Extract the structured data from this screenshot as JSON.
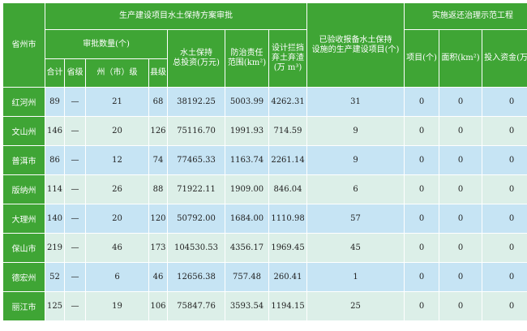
{
  "table": {
    "header": {
      "region": "省州市",
      "group_approval": "生产建设项目水土保持方案审批",
      "approval_count": "审批数量(个)",
      "total": "合计",
      "provincial": "省级",
      "prefecture": "州（市）级",
      "county": "县级",
      "investment_line1": "水土保持",
      "investment_line2": "总投资(万元)",
      "control_area_line1": "防治责任",
      "control_area_line2": "范围(km²)",
      "spoil_line1": "设计拦挡",
      "spoil_line2": "弃土弃渣",
      "spoil_line3": "(万 m³)",
      "accepted_line1": "已验收报备水土保持",
      "accepted_line2": "设施的生产建设项目(个)",
      "group_demo": "实施返还治理示范工程",
      "projects": "项目(个)",
      "area": "面积(km²)",
      "funds": "投入资金(万元)"
    },
    "rows": [
      {
        "region": "红河州",
        "total": "89",
        "provincial": "—",
        "prefecture": "21",
        "county": "68",
        "investment": "38192.25",
        "control_area": "5003.99",
        "spoil": "4262.31",
        "accepted": "31",
        "projects": "0",
        "area": "0",
        "funds": "0"
      },
      {
        "region": "文山州",
        "total": "146",
        "provincial": "—",
        "prefecture": "20",
        "county": "126",
        "investment": "75116.70",
        "control_area": "1991.93",
        "spoil": "714.59",
        "accepted": "9",
        "projects": "0",
        "area": "0",
        "funds": "0"
      },
      {
        "region": "普洱市",
        "total": "86",
        "provincial": "—",
        "prefecture": "12",
        "county": "74",
        "investment": "77465.33",
        "control_area": "1163.74",
        "spoil": "2261.14",
        "accepted": "9",
        "projects": "0",
        "area": "0",
        "funds": "0"
      },
      {
        "region": "版纳州",
        "total": "114",
        "provincial": "—",
        "prefecture": "26",
        "county": "88",
        "investment": "71922.11",
        "control_area": "1909.00",
        "spoil": "846.04",
        "accepted": "6",
        "projects": "0",
        "area": "0",
        "funds": "0"
      },
      {
        "region": "大理州",
        "total": "140",
        "provincial": "—",
        "prefecture": "20",
        "county": "120",
        "investment": "50792.00",
        "control_area": "1684.00",
        "spoil": "1110.98",
        "accepted": "57",
        "projects": "0",
        "area": "0",
        "funds": "0"
      },
      {
        "region": "保山市",
        "total": "219",
        "provincial": "—",
        "prefecture": "46",
        "county": "173",
        "investment": "104530.53",
        "control_area": "4356.17",
        "spoil": "1969.45",
        "accepted": "45",
        "projects": "0",
        "area": "0",
        "funds": "0"
      },
      {
        "region": "德宏州",
        "total": "52",
        "provincial": "—",
        "prefecture": "6",
        "county": "46",
        "investment": "12656.38",
        "control_area": "757.48",
        "spoil": "260.41",
        "accepted": "1",
        "projects": "0",
        "area": "0",
        "funds": "0"
      },
      {
        "region": "丽江市",
        "total": "125",
        "provincial": "—",
        "prefecture": "19",
        "county": "106",
        "investment": "75847.76",
        "control_area": "3593.54",
        "spoil": "1194.15",
        "accepted": "25",
        "projects": "0",
        "area": "0",
        "funds": "0"
      }
    ]
  }
}
